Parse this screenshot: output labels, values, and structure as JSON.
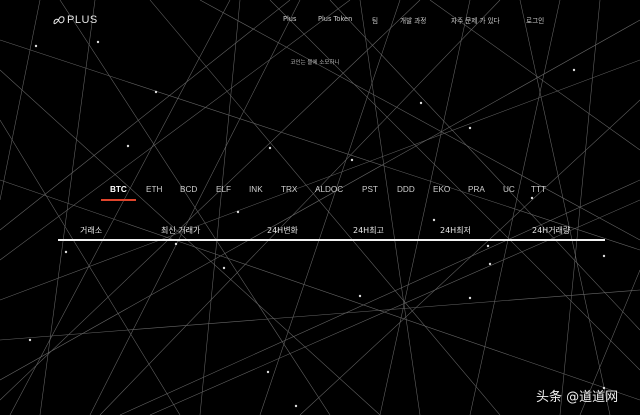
{
  "logo": {
    "text": "PLUS"
  },
  "nav": {
    "items": [
      {
        "label": "Plus"
      },
      {
        "label": "Plus Token"
      },
      {
        "label": "팀"
      },
      {
        "label": "개발 과정"
      },
      {
        "label": "자주 문제 가 있다"
      },
      {
        "label": "로그인"
      }
    ]
  },
  "subtitle": "코인는 블에 소모하니",
  "coins": {
    "active": "BTC",
    "tabs": [
      "BTC",
      "ETH",
      "BCD",
      "ELF",
      "INK",
      "TRX",
      "ALDOC",
      "PST",
      "DDD",
      "EKO",
      "PRA",
      "UC",
      "TTT"
    ]
  },
  "table": {
    "headers": [
      "거래소",
      "최신 거래가",
      "24H변화",
      "24H최고",
      "24H최저",
      "24H거래량"
    ]
  },
  "watermark": "头条 @道道网",
  "colors": {
    "background": "#000000",
    "accent": "#e0452c",
    "text": "#d8d8d8"
  }
}
